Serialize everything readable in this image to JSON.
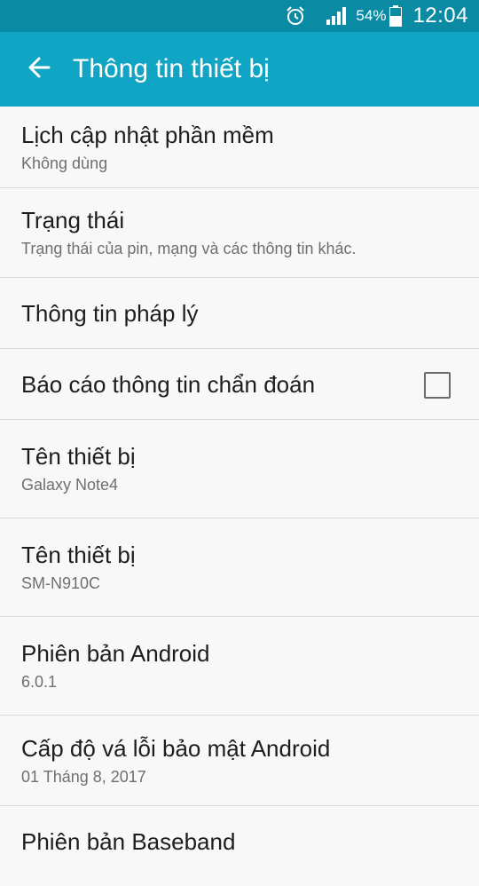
{
  "status_bar": {
    "battery_percent": "54%",
    "time": "12:04",
    "icons": [
      "alarm-icon",
      "signal-icon",
      "battery-icon"
    ]
  },
  "app_bar": {
    "title": "Thông tin thiết bị",
    "back_icon": "arrow-left-icon",
    "color": "#10a5c4"
  },
  "items": [
    {
      "title": "Lịch cập nhật phần mềm",
      "summary": "Không dùng"
    },
    {
      "title": "Trạng thái",
      "summary": "Trạng thái của pin, mạng và các thông tin khác."
    },
    {
      "title": "Thông tin pháp lý"
    },
    {
      "title": "Báo cáo thông tin chẩn đoán",
      "checked": false
    },
    {
      "title": "Tên thiết bị",
      "summary": "Galaxy Note4"
    },
    {
      "title": "Tên thiết bị",
      "summary": "SM-N910C"
    },
    {
      "title": "Phiên bản Android",
      "summary": "6.0.1"
    },
    {
      "title": "Cấp độ vá lỗi bảo mật Android",
      "summary": "01 Tháng 8, 2017"
    },
    {
      "title": "Phiên bản Baseband"
    }
  ]
}
